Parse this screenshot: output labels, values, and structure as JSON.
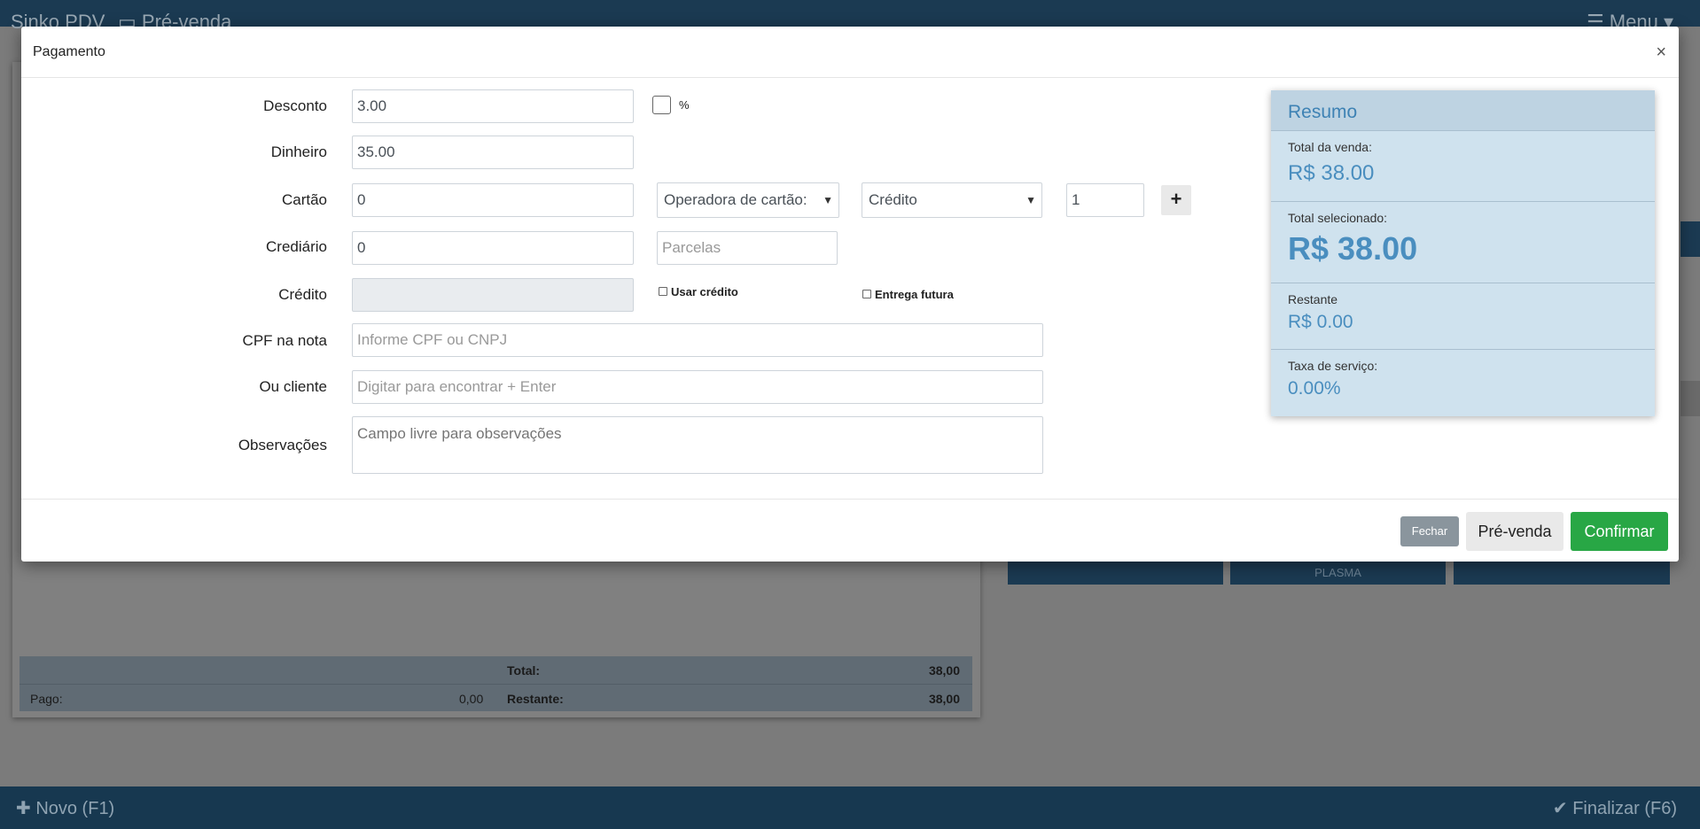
{
  "background": {
    "brand": "Sinko PDV",
    "prevenda_link": "▭ Pré-venda",
    "menu": "☰ Menu ▾",
    "totals": {
      "total_label": "Total:",
      "total_value": "38,00",
      "pago_label": "Pago:",
      "pago_value": "0,00",
      "restante_label": "Restante:",
      "restante_value": "38,00"
    },
    "tiles": [
      "",
      "PLASMA",
      ""
    ],
    "novo_label": "✚ Novo (F1)",
    "finalizar_label": "✔ Finalizar (F6)"
  },
  "modal": {
    "title": "Pagamento",
    "close_icon": "×",
    "fields": {
      "desconto": {
        "label": "Desconto",
        "value": "3.00",
        "percent_label": "%"
      },
      "dinheiro": {
        "label": "Dinheiro",
        "value": "35.00"
      },
      "cartao": {
        "label": "Cartão",
        "value": "0",
        "operadora": "Operadora de cartão:",
        "tipo": "Crédito",
        "parcelas": "1"
      },
      "crediario": {
        "label": "Crediário",
        "value": "0",
        "parcelas_placeholder": "Parcelas"
      },
      "credito": {
        "label": "Crédito",
        "usar_credito": "Usar crédito",
        "entrega_futura": "Entrega futura"
      },
      "cpf": {
        "label": "CPF na nota",
        "placeholder": "Informe CPF ou CNPJ"
      },
      "cliente": {
        "label": "Ou cliente",
        "placeholder": "Digitar para encontrar + Enter"
      },
      "observacoes": {
        "label": "Observações",
        "placeholder": "Campo livre para observações"
      }
    },
    "summary": {
      "title": "Resumo",
      "total_venda_label": "Total da venda:",
      "total_venda_value": "R$ 38.00",
      "total_selecionado_label": "Total selecionado:",
      "total_selecionado_value": "R$ 38.00",
      "restante_label": "Restante",
      "restante_value": "R$ 0.00",
      "taxa_label": "Taxa de serviço:",
      "taxa_value": "0.00%"
    },
    "buttons": {
      "fechar": "Fechar",
      "prevenda": "Pré-venda",
      "confirmar": "Confirmar"
    },
    "plus_icon": "+"
  }
}
